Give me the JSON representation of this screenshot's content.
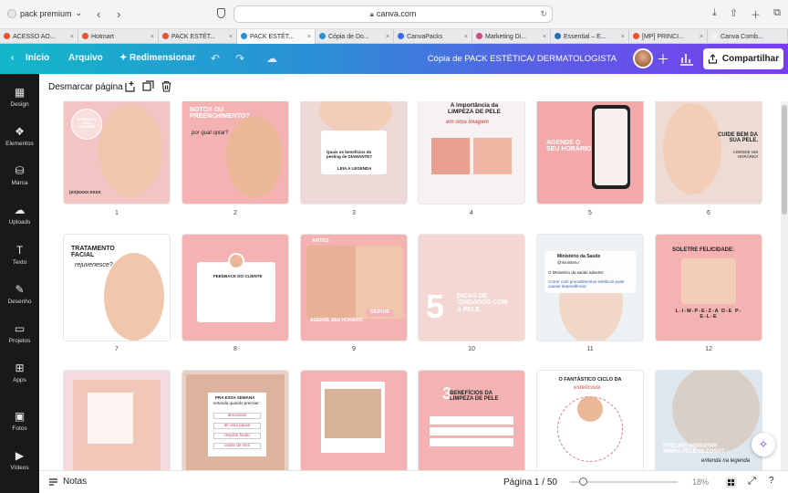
{
  "browser": {
    "profile": "pack premium",
    "url": "canva.com",
    "tabs": [
      {
        "label": "ACESSO AO...",
        "color": "#e8542c"
      },
      {
        "label": "Hotmart",
        "color": "#e8542c"
      },
      {
        "label": "PACK ESTÉT...",
        "color": "#e8542c"
      },
      {
        "label": "PACK ESTÉT...",
        "color": "#2b8fd5"
      },
      {
        "label": "Cópia de Do...",
        "color": "#2b8fd5"
      },
      {
        "label": "CanvaPacks",
        "color": "#3c6bf2"
      },
      {
        "label": "Marketing Di...",
        "color": "#d04c7e"
      },
      {
        "label": "Essential – E...",
        "color": "#2370b8"
      },
      {
        "label": "[MP] PRINCI...",
        "color": "#e8542c"
      },
      {
        "label": "Canva Comb...",
        "color": "#f4f4f5"
      }
    ]
  },
  "topbar": {
    "home": "Início",
    "file": "Arquivo",
    "resize": "Redimensionar",
    "title": "Cópia de PACK ESTÉTICA/ DERMATOLOGISTA",
    "share": "Compartilhar"
  },
  "sidebar": [
    {
      "label": "Design",
      "icon": "layout-icon"
    },
    {
      "label": "Elementos",
      "icon": "shapes-icon"
    },
    {
      "label": "Marca",
      "icon": "brand-icon"
    },
    {
      "label": "Uploads",
      "icon": "upload-icon"
    },
    {
      "label": "Texto",
      "icon": "text-icon"
    },
    {
      "label": "Desenho",
      "icon": "pen-icon"
    },
    {
      "label": "Projetos",
      "icon": "folder-icon"
    },
    {
      "label": "Apps",
      "icon": "apps-icon"
    },
    {
      "label": "Fotos",
      "icon": "image-icon"
    },
    {
      "label": "Vídeos",
      "icon": "video-icon"
    }
  ],
  "toolbar": {
    "deselect": "Desmarcar página"
  },
  "pages": [
    {
      "n": "1",
      "title": "AGENDE O SEU HORÁRIO",
      "footer": "(XX)XXXX-XXXX",
      "bg": "#f3c4c4"
    },
    {
      "n": "2",
      "title": "BOTOX OU PREENCHIMENTO?",
      "sub": "por qual optar?",
      "bg": "#f5b2b2"
    },
    {
      "n": "3",
      "title": "Quais os benefícios do peeling de DIAMANTE?",
      "sub": "LEIA A LEGENDA",
      "bg": "#eed8d8"
    },
    {
      "n": "4",
      "title": "A importância da LIMPEZA DE PELE",
      "sub": "em uma imagem",
      "bg": "#f7f1f1"
    },
    {
      "n": "5",
      "title": "AGENDE O SEU HORÁRIO",
      "bg": "#f3a9a9"
    },
    {
      "n": "6",
      "title": "CUIDE BEM DA SUA PELE.",
      "sub": "AGENDE UM HORÁRIO!",
      "bg": "#eedcd4"
    },
    {
      "n": "7",
      "title": "TRATAMENTO FACIAL",
      "sub": "rejuvenesce?",
      "bg": "#ffffff"
    },
    {
      "n": "8",
      "title": "FEEDBACK DO CLIENTE",
      "bg": "#f5b2b2"
    },
    {
      "n": "9",
      "title": "ANTES",
      "sub": "DEPOIS",
      "footer": "AGENDE SEU HORÁRIO",
      "bg": "#f5b2b2"
    },
    {
      "n": "10",
      "title": "DICAS DE CUIDADOS COM A PELE.",
      "big": "5",
      "bg": "#f4d7d3"
    },
    {
      "n": "11",
      "title": "Ministério da Saúde",
      "sub": "@ministerio",
      "body": "O Ministério da saúde adverte:",
      "body2": "Correr com procedimentos estéticos pode causar dependência!",
      "bg": "#eef1f4"
    },
    {
      "n": "12",
      "title": "SOLETRE FELICIDADE:",
      "sub": "L-I-M-P-E-Z-A D-E P-E-L-E",
      "bg": "#f5b2b2"
    },
    {
      "n": "13",
      "bg": "#f4dcde"
    },
    {
      "n": "14",
      "title": "PRA ESSA SEMANA",
      "sub": "entenda quando precisar:",
      "opts": [
        "descansar",
        "ter uma pausa",
        "respirar fundo",
        "cuidar de mim"
      ],
      "bg": "#e9d0c4"
    },
    {
      "n": "15",
      "bg": "#f5b2b2"
    },
    {
      "n": "16",
      "title": "BENEFÍCIOS DA LIMPEZA DE PELE",
      "big": "3",
      "bg": "#f5b2b2"
    },
    {
      "n": "17",
      "title": "O FANTÁSTICO CICLO DA",
      "sub": "esteticista",
      "bg": "#ffffff"
    },
    {
      "n": "18",
      "title": "PRECISO HIDRATAR MINHA PELE OLEOSA?",
      "sub": "entenda na legenda",
      "bg": "#dfe7ee"
    }
  ],
  "bottombar": {
    "notes": "Notas",
    "page": "Página 1 / 50",
    "zoom": "18%"
  }
}
